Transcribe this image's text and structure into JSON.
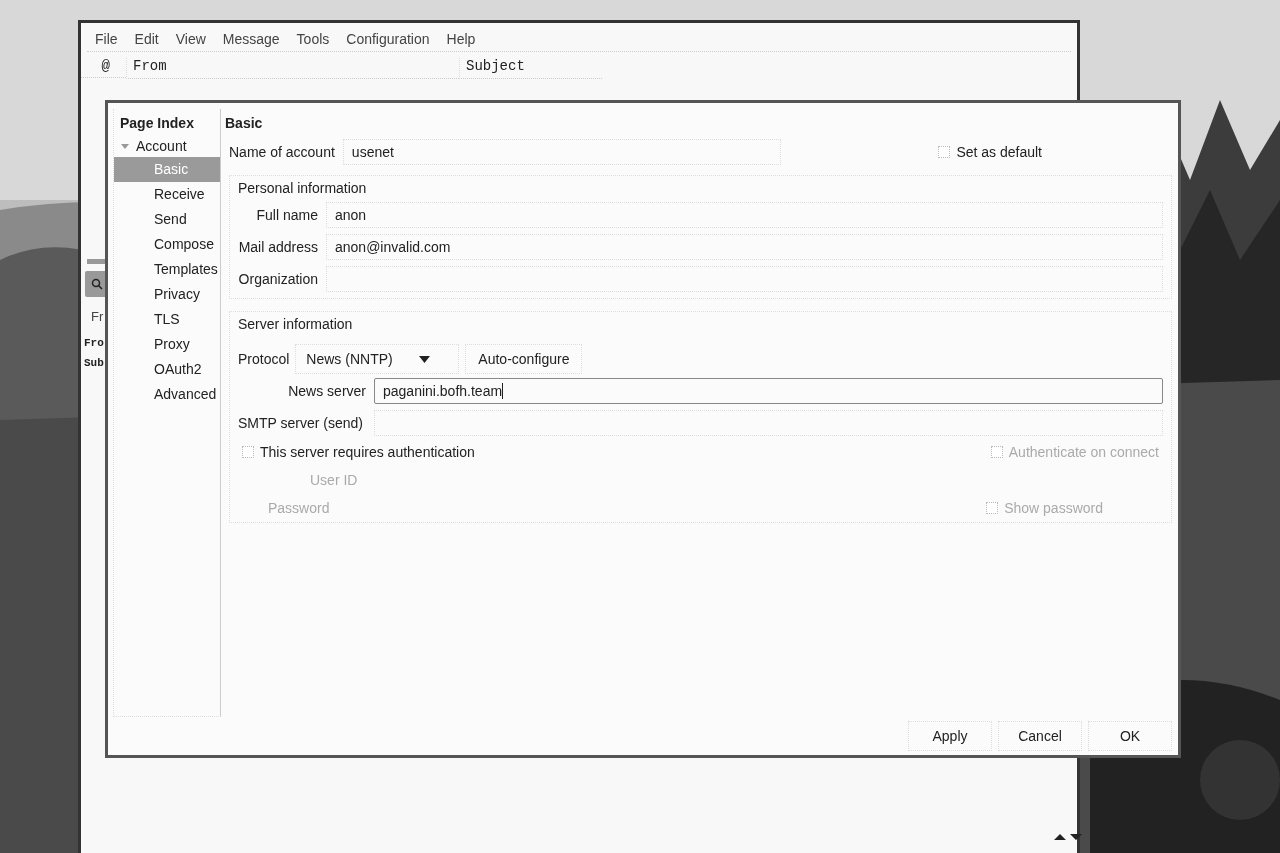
{
  "main_window": {
    "menu": [
      "File",
      "Edit",
      "View",
      "Message",
      "Tools",
      "Configuration",
      "Help"
    ],
    "columns": [
      {
        "label": "@"
      },
      {
        "label": "From"
      },
      {
        "label": "Subject"
      }
    ],
    "left_pane": {
      "tab_label": "Fr",
      "header_lines": [
        "Fro",
        "Sub"
      ]
    }
  },
  "dialog": {
    "sidebar_title": "Page Index",
    "tree": [
      {
        "label": "Account",
        "expanded": true,
        "children": [
          {
            "label": "Basic",
            "selected": true
          },
          {
            "label": "Receive",
            "selected": false
          },
          {
            "label": "Send",
            "selected": false
          },
          {
            "label": "Compose",
            "selected": false
          },
          {
            "label": "Templates",
            "selected": false
          },
          {
            "label": "Privacy",
            "selected": false
          },
          {
            "label": "TLS",
            "selected": false
          },
          {
            "label": "Proxy",
            "selected": false
          },
          {
            "label": "OAuth2",
            "selected": false
          },
          {
            "label": "Advanced",
            "selected": false
          }
        ]
      }
    ],
    "heading": "Basic",
    "account_name": {
      "label": "Name of account",
      "value": "usenet"
    },
    "set_default": {
      "label": "Set as default",
      "checked": false
    },
    "personal": {
      "title": "Personal information",
      "fields": [
        {
          "label": "Full name",
          "value": "anon"
        },
        {
          "label": "Mail address",
          "value": "anon@invalid.com"
        },
        {
          "label": "Organization"
        }
      ]
    },
    "server": {
      "title": "Server information",
      "protocol_label": "Protocol",
      "protocol": "News (NNTP)",
      "autoconfig": "Auto-configure",
      "fields": [
        {
          "label": "News server",
          "value": "paganini.bofh.team",
          "focused": true
        },
        {
          "label": "SMTP server (send)",
          "focused": false
        }
      ],
      "auth": {
        "label": "This server requires authentication",
        "checked": false,
        "disabled": false
      },
      "auth_on_connect": {
        "label": "Authenticate on connect",
        "checked": false,
        "disabled": true
      },
      "user_id": {
        "label": "User ID",
        "disabled": true
      },
      "password": {
        "label": "Password",
        "disabled": true
      },
      "show_password": {
        "label": "Show password",
        "checked": false,
        "disabled": true
      }
    },
    "buttons": [
      "Apply",
      "Cancel",
      "OK"
    ]
  }
}
